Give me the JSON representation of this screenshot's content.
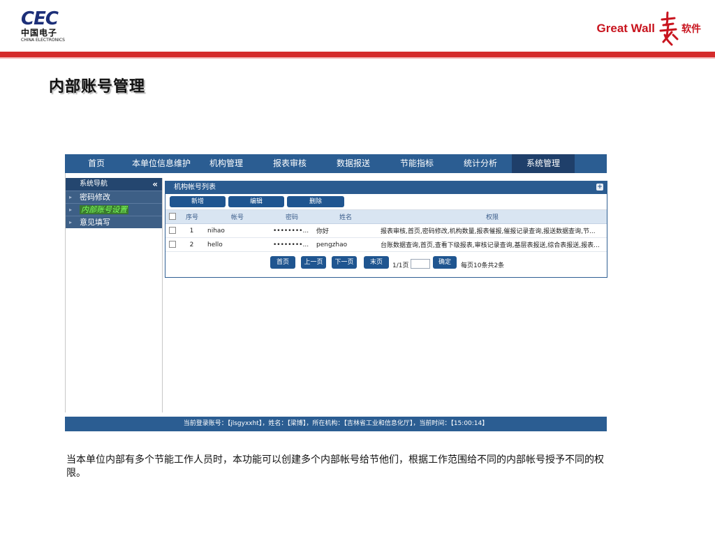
{
  "header": {
    "cec_logo_mark": "CEC",
    "cec_logo_cn": "中国电子",
    "cec_logo_en": "CHINA ELECTRONICS",
    "gw_logo_text": "Great Wall",
    "gw_logo_soft": "软件",
    "slide_title": "内部账号管理"
  },
  "app": {
    "nav": [
      {
        "label": "首页",
        "active": false
      },
      {
        "label": "本单位信息维护",
        "active": false
      },
      {
        "label": "机构管理",
        "active": false
      },
      {
        "label": "报表审核",
        "active": false
      },
      {
        "label": "数据报送",
        "active": false
      },
      {
        "label": "节能指标",
        "active": false
      },
      {
        "label": "统计分析",
        "active": false
      },
      {
        "label": "系统管理",
        "active": true
      }
    ],
    "sidebar": {
      "title": "系统导航",
      "collapse_label": "«",
      "items": [
        {
          "label": "密码修改",
          "active": false
        },
        {
          "label": "内部账号设置",
          "active": true
        },
        {
          "label": "意见填写",
          "active": false
        }
      ]
    },
    "panel": {
      "title": "机构帐号列表",
      "pin_label": "+",
      "toolbar": {
        "add_label": "新增",
        "edit_label": "编辑",
        "delete_label": "删除"
      },
      "columns": [
        "序号",
        "帐号",
        "密码",
        "姓名",
        "权限"
      ],
      "rows": [
        {
          "index": "1",
          "account": "nihao",
          "password": "••••••••...",
          "name": "你好",
          "permissions": "报表审核,首页,密码修改,机构数量,报表催报,催报记录查询,报送数据查询,节..."
        },
        {
          "index": "2",
          "account": "hello",
          "password": "••••••••...",
          "name": "pengzhao",
          "permissions": "台账数据查询,首页,查看下级报表,审核记录查询,基层表报送,综合表报送,报表..."
        }
      ],
      "pager": {
        "first_label": "首页",
        "prev_label": "上一页",
        "next_label": "下一页",
        "last_label": "末页",
        "page_info": "1/1页",
        "goto_value": "",
        "confirm_label": "确定",
        "summary": "每页10条共2条"
      }
    },
    "status_bar": "当前登录账号：【jlsgyxxht】，姓名：【梁博】，所在机构：【吉林省工业和信息化厅】，当前时间：【15:00:14】"
  },
  "caption": "当本单位内部有多个节能工作人员时，本功能可以创建多个内部帐号给节他们，根据工作范围给不同的内部帐号授予不同的权限。"
}
